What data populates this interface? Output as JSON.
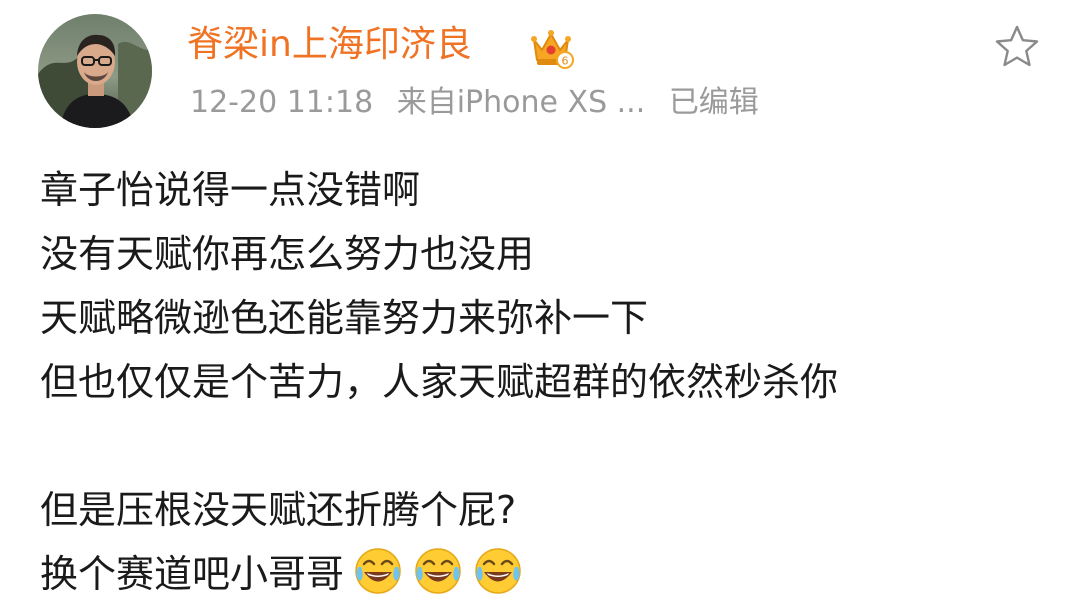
{
  "post": {
    "author": "脊梁in上海印济良",
    "badge_icon": "crown-member-icon",
    "badge_level": "6",
    "timestamp": "12-20 11:18",
    "source": "来自iPhone XS ...",
    "edited_label": "已编辑",
    "favorite_icon": "star-outline-icon",
    "lines": [
      "章子怡说得一点没错啊",
      "没有天赋你再怎么努力也没用",
      "天赋略微逊色还能靠努力来弥补一下",
      "但也仅仅是个苦力，人家天赋超群的依然秒杀你",
      "",
      "但是压根没天赋还折腾个屁?",
      "换个赛道吧小哥哥"
    ],
    "emojis": [
      "laugh-cry-emoji",
      "laugh-cry-emoji",
      "laugh-cry-emoji"
    ]
  },
  "colors": {
    "author": "#f07223",
    "meta": "#9a9a9a",
    "text": "#1a1a1a",
    "badge": "#f5a623"
  }
}
